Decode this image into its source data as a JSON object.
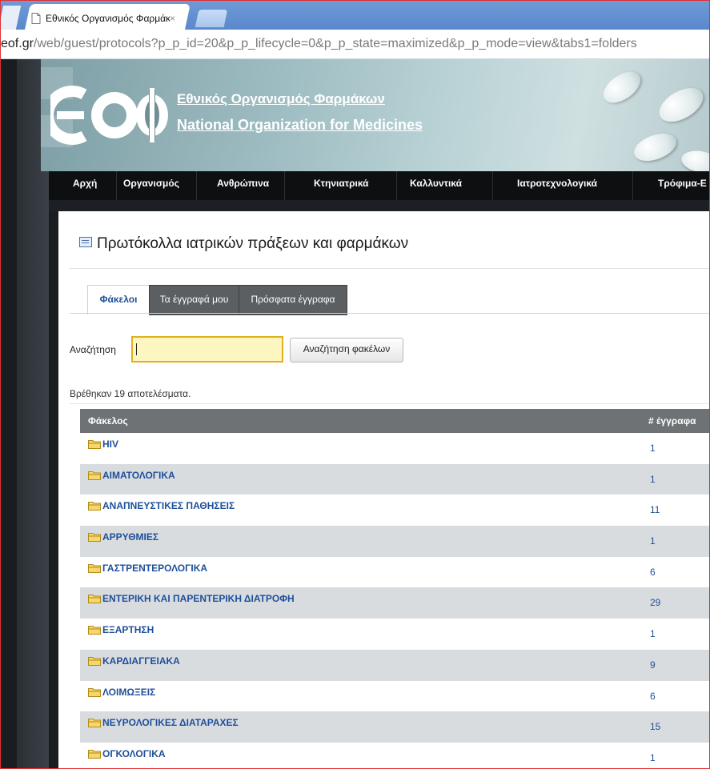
{
  "browser": {
    "tab_title": "Εθνικός Οργανισμός Φαρμάκ",
    "tab_close": "×",
    "url_host": "eof.gr",
    "url_path": "/web/guest/protocols?p_p_id=20&p_p_lifecycle=0&p_p_state=maximized&p_p_mode=view&tabs1=folders"
  },
  "header": {
    "brand_greek": "Εθνικός Οργανισμός Φαρμάκων",
    "brand_english": "National Organization for Medicines"
  },
  "nav": {
    "items": [
      "Αρχή",
      "Οργανισμός",
      "Ανθρώπινα",
      "Κτηνιατρικά",
      "Καλλυντικά",
      "Ιατροτεχνολογικά",
      "Τρόφιμα-Ε"
    ]
  },
  "portlet": {
    "title": "Πρωτόκολλα ιατρικών πράξεων και φαρμάκων",
    "tabs": [
      "Φάκελοι",
      "Τα έγγραφά μου",
      "Πρόσφατα έγγραφα"
    ],
    "active_tab": "Φάκελοι",
    "search_label": "Αναζήτηση",
    "search_value": "",
    "search_button": "Αναζήτηση φακέλων",
    "results_text": "Βρέθηκαν 19 αποτελέσματα.",
    "table": {
      "headers": [
        "Φάκελος",
        "# έγγραφα"
      ],
      "rows": [
        {
          "name": "HIV",
          "count": "1"
        },
        {
          "name": "ΑΙΜΑΤΟΛΟΓΙΚΑ",
          "count": "1"
        },
        {
          "name": "ΑΝΑΠΝΕΥΣΤΙΚΕΣ ΠΑΘΗΣΕΙΣ",
          "count": "11"
        },
        {
          "name": "ΑΡΡΥΘΜΙΕΣ",
          "count": "1"
        },
        {
          "name": "ΓΑΣΤΡΕΝΤΕΡΟΛΟΓΙΚΑ",
          "count": "6"
        },
        {
          "name": "ΕΝΤΕΡΙΚΗ ΚΑΙ ΠΑΡΕΝΤΕΡΙΚΗ ΔΙΑΤΡΟΦΗ",
          "count": "29"
        },
        {
          "name": "ΕΞΑΡΤΗΣΗ",
          "count": "1"
        },
        {
          "name": "ΚΑΡΔΙΑΓΓΕΙΑΚΑ",
          "count": "9"
        },
        {
          "name": "ΛΟΙΜΩΞΕΙΣ",
          "count": "6"
        },
        {
          "name": "ΝΕΥΡΟΛΟΓΙΚΕΣ ΔΙΑΤΑΡΑΧΕΣ",
          "count": "15"
        },
        {
          "name": "ΟΓΚΟΛΟΓΙΚΑ",
          "count": "1"
        }
      ]
    }
  },
  "colors": {
    "link": "#1e4f9a",
    "nav_bg": "#0d0f10",
    "table_header": "#6e7275",
    "row_alt": "#d9dcdf",
    "search_bg": "#fdf6c0",
    "search_border": "#e0b020"
  }
}
